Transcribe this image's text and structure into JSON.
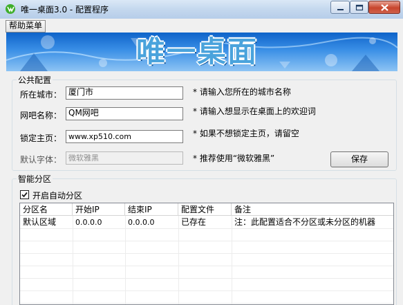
{
  "window": {
    "title": "唯一桌面3.0 - 配置程序",
    "icon": "app-logo-icon"
  },
  "menu": {
    "help": "帮助菜单"
  },
  "banner": {
    "logo_text": "唯一桌面",
    "colors": {
      "sky": "#2f86e0",
      "logo_fill": "#4a9fd9",
      "logo_outline": "#ffffff"
    }
  },
  "public_config": {
    "legend": "公共配置",
    "city": {
      "label": "所在城市：",
      "value": "厦门市",
      "hint": "* 请输入您所在的城市名称"
    },
    "netbar": {
      "label": "网吧名称：",
      "value": "QM网吧",
      "hint": "* 请输入想显示在桌面上的欢迎词"
    },
    "homepage": {
      "label": "锁定主页：",
      "value": "www.xp510.com",
      "hint": "* 如果不想锁定主页，请留空"
    },
    "font": {
      "label": "默认字体：",
      "value": "微软雅黑",
      "hint": "* 推荐使用“微软雅黑”"
    },
    "save_label": "保存"
  },
  "smart_partition": {
    "legend": "智能分区",
    "auto_checkbox": {
      "label": "开启自动分区",
      "checked": true
    },
    "columns": [
      "分区名",
      "开始IP",
      "结束IP",
      "配置文件",
      "备注"
    ],
    "rows": [
      [
        "默认区域",
        "0.0.0.0",
        "0.0.0.0",
        "已存在",
        "注：此配置适合不分区或未分区的机器"
      ]
    ]
  }
}
